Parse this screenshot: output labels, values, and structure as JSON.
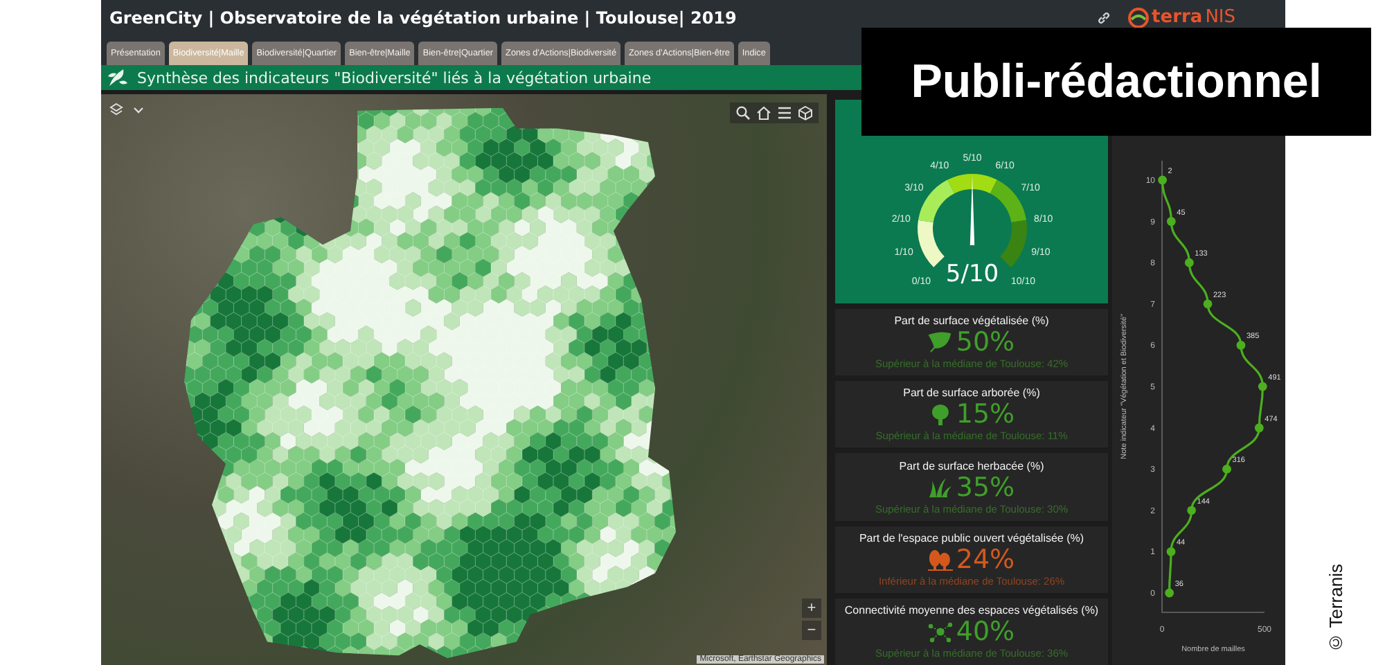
{
  "header": {
    "title": "GreenCity | Observatoire de la végétation urbaine | Toulouse| 2019",
    "logo": {
      "part_1": "terra",
      "part_2": "NIS"
    }
  },
  "tabs": [
    {
      "label": "Présentation",
      "selected": false
    },
    {
      "label": "Biodiversité|Maille",
      "selected": true
    },
    {
      "label": "Biodiversité|Quartier",
      "selected": false
    },
    {
      "label": "Bien-être|Maille",
      "selected": false
    },
    {
      "label": "Bien-être|Quartier",
      "selected": false
    },
    {
      "label": "Zones d'Actions|Biodiversité",
      "selected": false
    },
    {
      "label": "Zones d'Actions|Bien-être",
      "selected": false
    },
    {
      "label": "Indice",
      "selected": false
    }
  ],
  "banner": {
    "title": "Synthèse des indicateurs \"Biodiversité\" liés à la végétation urbaine"
  },
  "map": {
    "attribution": "Microsoft, Earthstar Geographics",
    "zoom_in": "+",
    "zoom_out": "−"
  },
  "gauge": {
    "level": 0.5,
    "reading": "5/10",
    "ticks": [
      "0/10",
      "1/10",
      "2/10",
      "3/10",
      "4/10",
      "5/10",
      "6/10",
      "7/10",
      "8/10",
      "9/10",
      "10/10"
    ]
  },
  "indicators": [
    {
      "title": "Part de surface végétalisée (%)",
      "kind": "leaf",
      "value": "50%",
      "comparison": "Supérieur à la médiane de Toulouse: 42%",
      "color": "#3f9f2a"
    },
    {
      "title": "Part de surface arborée (%)",
      "kind": "tree",
      "value": "15%",
      "comparison": "Supérieur à la médiane de Toulouse: 11%",
      "color": "#3f9f2a"
    },
    {
      "title": "Part de surface herbacée (%)",
      "kind": "grass",
      "value": "35%",
      "comparison": "Supérieur à la médiane de Toulouse: 30%",
      "color": "#3f9f2a"
    },
    {
      "title": "Part de l'espace public ouvert végétalisée (%)",
      "kind": "trees",
      "value": "24%",
      "comparison": "Inférieur à la médiane de Toulouse: 26%",
      "color": "#d4581c"
    },
    {
      "title": "Connectivité moyenne des espaces végétalisés (%)",
      "kind": "network",
      "value": "40%",
      "comparison": "Supérieur à la médiane de Toulouse: 36%",
      "color": "#3f9f2a"
    }
  ],
  "chart": {
    "chart_data": {
      "type": "line",
      "orientation": "horizontal",
      "xlabel": "Nombre de mailles",
      "ylabel": "Note indicateur \"Végétation et Biodiversité\"",
      "categories": [
        "10",
        "9",
        "8",
        "7",
        "6",
        "5",
        "4",
        "3",
        "2",
        "1",
        "0"
      ],
      "series": [
        {
          "color": "#4caf1e",
          "marker": "circle",
          "values": [
            2,
            45,
            133,
            223,
            385,
            491,
            474,
            316,
            144,
            44,
            36
          ]
        }
      ],
      "xlim": [
        0,
        500
      ],
      "xticks": [
        0,
        500
      ],
      "data_labels": true
    }
  },
  "overlay": {
    "label": "Publi-rédactionnel"
  },
  "credit": "© Terranis"
}
